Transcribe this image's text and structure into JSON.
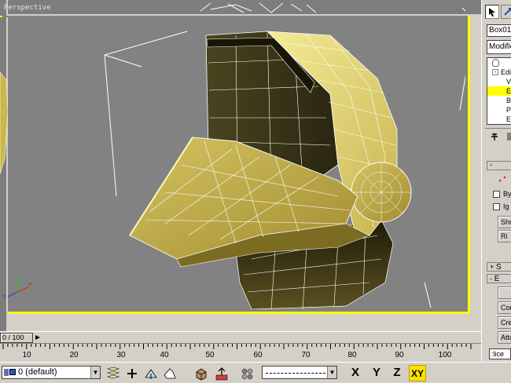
{
  "viewport": {
    "label": "Perspective",
    "object_color": "#e8d870",
    "wire_color": "#ffffff",
    "background": "#828282",
    "active_border": "#ffff00"
  },
  "command_panel": {
    "tabs": [
      "create-icon",
      "modify-icon"
    ],
    "object_name": "Box01",
    "modifier_list": "Modifie",
    "stack": [
      {
        "label": "Edi",
        "selected": false
      },
      {
        "label": "V",
        "selected": false
      },
      {
        "label": "E",
        "selected": true
      },
      {
        "label": "B",
        "selected": false
      },
      {
        "label": "P",
        "selected": false
      },
      {
        "label": "E",
        "selected": false
      }
    ],
    "selection_rollout": "-",
    "by_label": "By",
    "ig_label": "Ig",
    "shrink_label": "Shr",
    "ring_label": "Ri",
    "soft_rollout": "S",
    "edit_rollout": "E",
    "create_label": "Cre",
    "connect_label": "Cor",
    "attach_label": "Atta",
    "slice_label": ":lice",
    "sl_label": "Sl"
  },
  "time_slider": {
    "label": "0 / 100"
  },
  "ruler": {
    "ticks": [
      "10",
      "20",
      "30",
      "40",
      "50",
      "60",
      "70",
      "80",
      "90",
      "100"
    ],
    "first": "0"
  },
  "bottom_bar": {
    "layer": "0 (default)",
    "axis_x": "X",
    "axis_y": "Y",
    "axis_z": "Z",
    "axis_xy": "XY"
  }
}
